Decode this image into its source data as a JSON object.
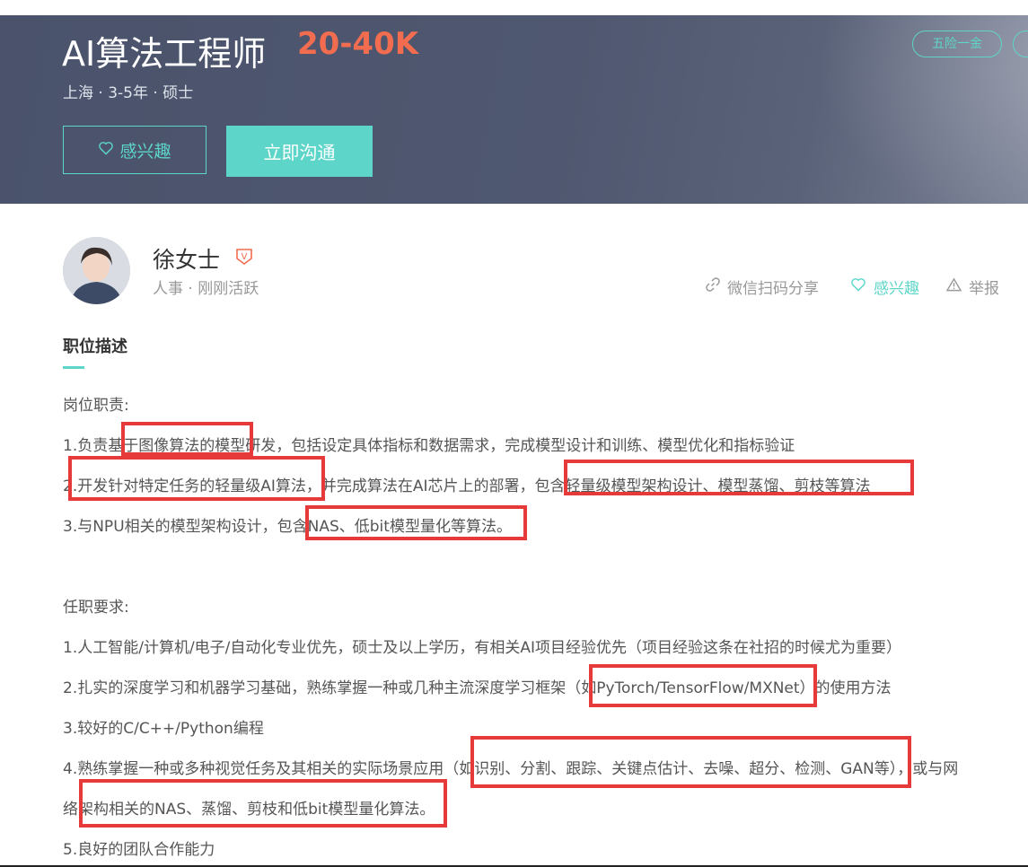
{
  "job": {
    "title": "AI算法工程师",
    "salary": "20-40K",
    "meta": "上海 · 3-5年 · 硕士",
    "tags": [
      "五险一金",
      ""
    ],
    "interest_button": "感兴趣",
    "chat_button": "立即沟通"
  },
  "recruiter": {
    "name": "徐女士",
    "verified_badge": "V",
    "meta": "人事 ·  刚刚活跃"
  },
  "actions": {
    "share": "微信扫码分享",
    "like": "感兴趣",
    "report": "举报"
  },
  "description": {
    "section_title": "职位描述",
    "lines": [
      "岗位职责:",
      "1.负责基于图像算法的模型研发，包括设定具体指标和数据需求，完成模型设计和训练、模型优化和指标验证",
      "2.开发针对特定任务的轻量级AI算法，并完成算法在AI芯片上的部署，包含轻量级模型架构设计、模型蒸馏、剪枝等算法",
      "3.与NPU相关的模型架构设计，包含NAS、低bit模型量化等算法。",
      "任职要求:",
      "1.人工智能/计算机/电子/自动化专业优先，硕士及以上学历，有相关AI项目经验优先（项目经验这条在社招的时候尤为重要）",
      "2.扎实的深度学习和机器学习基础，熟练掌握一种或几种主流深度学习框架（如PyTorch/TensorFlow/MXNet）的使用方法",
      "3.较好的C/C++/Python编程",
      "4.熟练掌握一种或多种视觉任务及其相关的实际场景应用（如识别、分割、跟踪、关键点估计、去噪、超分、检测、GAN等），或与网",
      "络架构相关的NAS、蒸馏、剪枝和低bit模型量化算法。",
      "5.良好的团队合作能力"
    ]
  },
  "colors": {
    "accent": "#5dd5c8",
    "salary": "#f26d4f",
    "banner": "#4f5870",
    "highlight_box": "#e63a3a"
  },
  "icons": {
    "heart": "heart-icon",
    "link": "link-icon",
    "warning": "warning-icon",
    "verified": "verified-badge-icon"
  }
}
